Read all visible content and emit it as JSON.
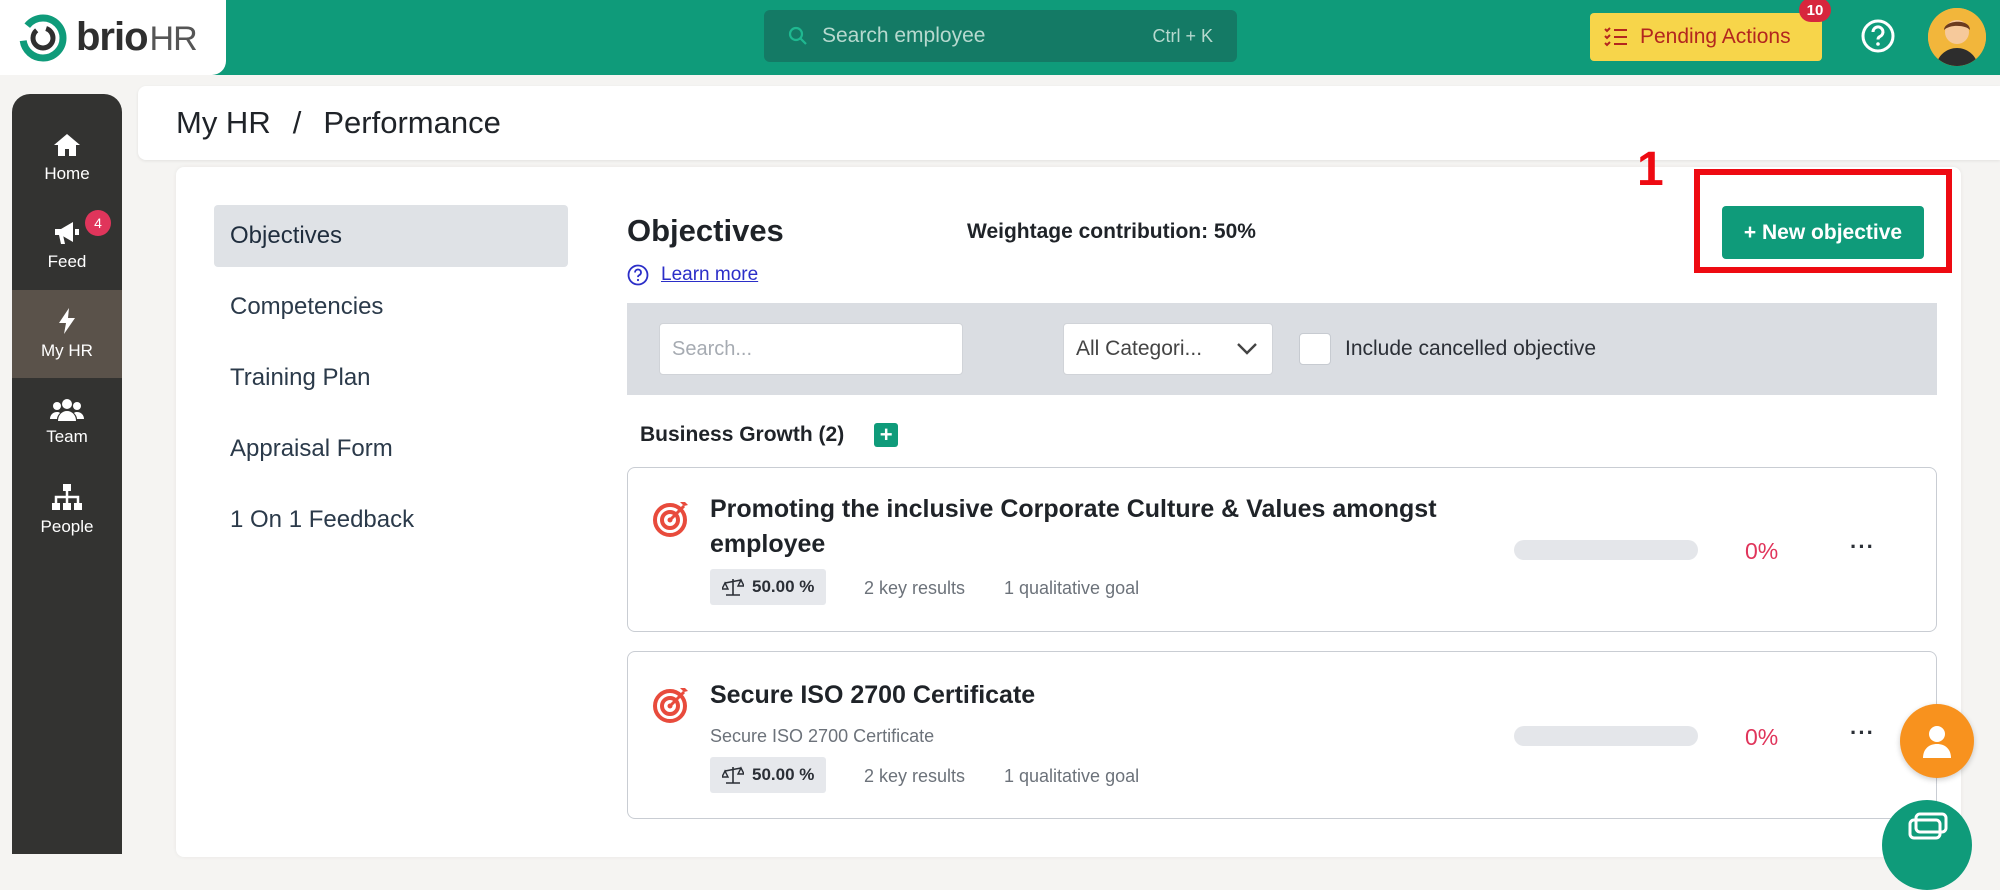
{
  "brand": {
    "name": "brio",
    "suffix": "HR"
  },
  "topbar": {
    "search_placeholder": "Search employee",
    "search_shortcut": "Ctrl + K",
    "pending_label": "Pending Actions",
    "pending_count": "10"
  },
  "sidebar": {
    "items": [
      {
        "label": "Home",
        "icon": "home-icon"
      },
      {
        "label": "Feed",
        "icon": "megaphone-icon",
        "badge": "4"
      },
      {
        "label": "My HR",
        "icon": "lightning-icon",
        "active": true
      },
      {
        "label": "Team",
        "icon": "team-icon"
      },
      {
        "label": "People",
        "icon": "org-chart-icon"
      }
    ]
  },
  "breadcrumb": {
    "root": "My HR",
    "separator": "/",
    "current": "Performance"
  },
  "menu": {
    "items": [
      "Objectives",
      "Competencies",
      "Training Plan",
      "Appraisal Form",
      "1 On 1 Feedback"
    ],
    "active": "Objectives"
  },
  "objectives": {
    "title": "Objectives",
    "weightage": "Weightage contribution: 50%",
    "learn_more": "Learn more",
    "new_button": "+ New objective",
    "annotation_number": "1"
  },
  "filters": {
    "search_placeholder": "Search...",
    "category_value": "All Categori...",
    "include_cancelled": "Include cancelled objective"
  },
  "group": {
    "title": "Business Growth (2)"
  },
  "cards": [
    {
      "title": "Promoting the inclusive Corporate Culture & Values amongst employee",
      "subtitle": "",
      "weight": "50.00 %",
      "key_results": "2 key results",
      "qual_goal": "1 qualitative goal",
      "progress": 0,
      "percent": "0%"
    },
    {
      "title": "Secure ISO 2700 Certificate",
      "subtitle": "Secure ISO 2700 Certificate",
      "weight": "50.00 %",
      "key_results": "2 key results",
      "qual_goal": "1 qualitative goal",
      "progress": 0,
      "percent": "0%"
    }
  ],
  "colors": {
    "brand_green": "#0f9b7a",
    "sidebar": "#333331",
    "pending": "#f7d54a",
    "accent_red": "#e0355b",
    "annotation_red": "#ee0a12"
  }
}
